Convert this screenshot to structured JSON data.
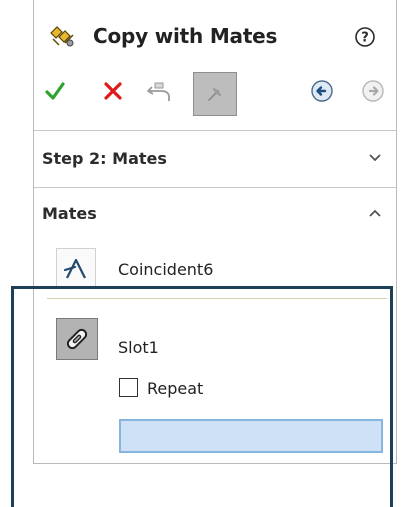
{
  "panel": {
    "title": "Copy with Mates",
    "title_icon": "copy-with-mates-icon",
    "help_icon": "help-icon"
  },
  "toolbar": {
    "ok_icon": "check-icon",
    "cancel_icon": "close-icon",
    "undo_icon": "undo-icon",
    "pin_icon": "pushpin-icon",
    "back_icon": "back-arrow-icon",
    "next_icon": "next-arrow-icon"
  },
  "step2": {
    "title": "Step 2: Mates",
    "collapsed": true
  },
  "mates": {
    "title": "Mates",
    "expanded": true,
    "items": [
      {
        "label": "Coincident6",
        "icon": "coincident-mate-icon",
        "selected": false
      },
      {
        "label": "Slot1",
        "icon": "slot-mate-icon",
        "selected": true
      }
    ],
    "repeat_label": "Repeat",
    "repeat_checked": false
  },
  "colors": {
    "ok": "#2fa32f",
    "cancel": "#e01a1a",
    "selection_fill": "#cfe1f6",
    "selection_border": "#86b5dd",
    "focus_frame": "#1d3f57"
  }
}
